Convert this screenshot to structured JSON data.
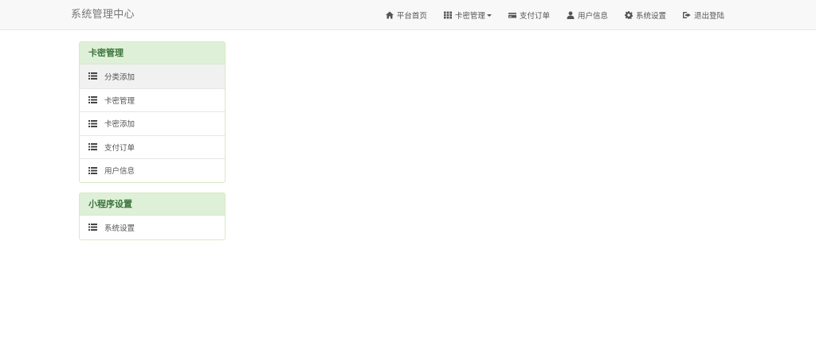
{
  "brand": "系统管理中心",
  "nav": {
    "items": [
      {
        "label": "平台首页",
        "icon": "home-icon"
      },
      {
        "label": "卡密管理",
        "icon": "th-grid-icon",
        "dropdown": true
      },
      {
        "label": "支付订单",
        "icon": "credit-card-icon"
      },
      {
        "label": "用户信息",
        "icon": "user-icon"
      },
      {
        "label": "系统设置",
        "icon": "cog-icon"
      },
      {
        "label": "退出登陆",
        "icon": "logout-icon"
      }
    ]
  },
  "sidebar": {
    "panels": [
      {
        "title": "卡密管理",
        "items": [
          {
            "label": "分类添加",
            "icon": "list-icon",
            "active": true
          },
          {
            "label": "卡密管理",
            "icon": "list-icon"
          },
          {
            "label": "卡密添加",
            "icon": "list-icon"
          },
          {
            "label": "支付订单",
            "icon": "list-icon"
          },
          {
            "label": "用户信息",
            "icon": "list-icon"
          }
        ]
      },
      {
        "title": "小程序设置",
        "items": [
          {
            "label": "系统设置",
            "icon": "list-icon"
          }
        ]
      }
    ]
  },
  "colors": {
    "navbar_bg": "#f8f8f8",
    "panel_heading_bg": "#dff0d8",
    "panel_heading_text": "#3c763d",
    "panel_border": "#d6e9c6",
    "active_item_bg": "#f1f1f1"
  }
}
